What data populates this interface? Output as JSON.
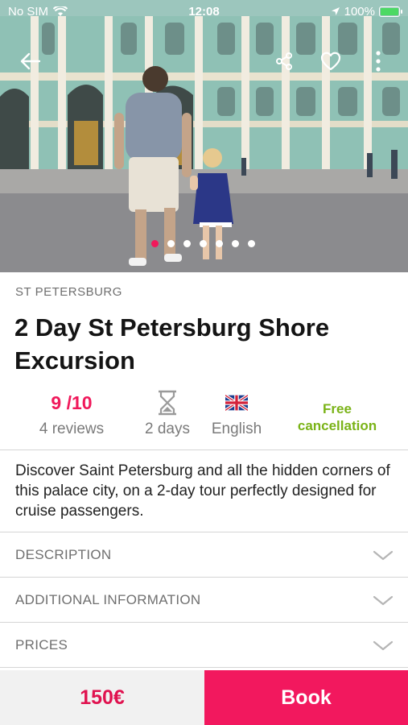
{
  "status_bar": {
    "carrier": "No SIM",
    "time": "12:08",
    "battery": "100%",
    "icons": [
      "wifi-icon",
      "location-arrow-icon",
      "battery-icon"
    ]
  },
  "top_bar": {
    "icons": [
      "back-arrow-icon",
      "share-icon",
      "heart-icon",
      "more-vertical-icon"
    ]
  },
  "gallery": {
    "count": 7,
    "active": 1
  },
  "tour": {
    "city": "ST PETERSBURG",
    "title": "2 Day St Petersburg Shore Excursion"
  },
  "stats": {
    "rating": "9 /10",
    "reviews": "4 reviews",
    "duration": "2 days",
    "duration_icon": "hourglass-icon",
    "language": "English",
    "language_icon": "uk-flag-icon",
    "cancellation": "Free cancellation"
  },
  "description": "Discover Saint Petersburg and all the hidden corners of this palace city, on a 2-day tour perfectly designed for cruise passengers.",
  "sections": [
    {
      "label": "DESCRIPTION"
    },
    {
      "label": "ADDITIONAL INFORMATION"
    },
    {
      "label": "PRICES"
    }
  ],
  "footer": {
    "price": "150€",
    "book_label": "Book"
  },
  "colors": {
    "accent": "#f0195b",
    "cancel_green": "#7ab317",
    "muted_text": "#6f6f6f"
  }
}
